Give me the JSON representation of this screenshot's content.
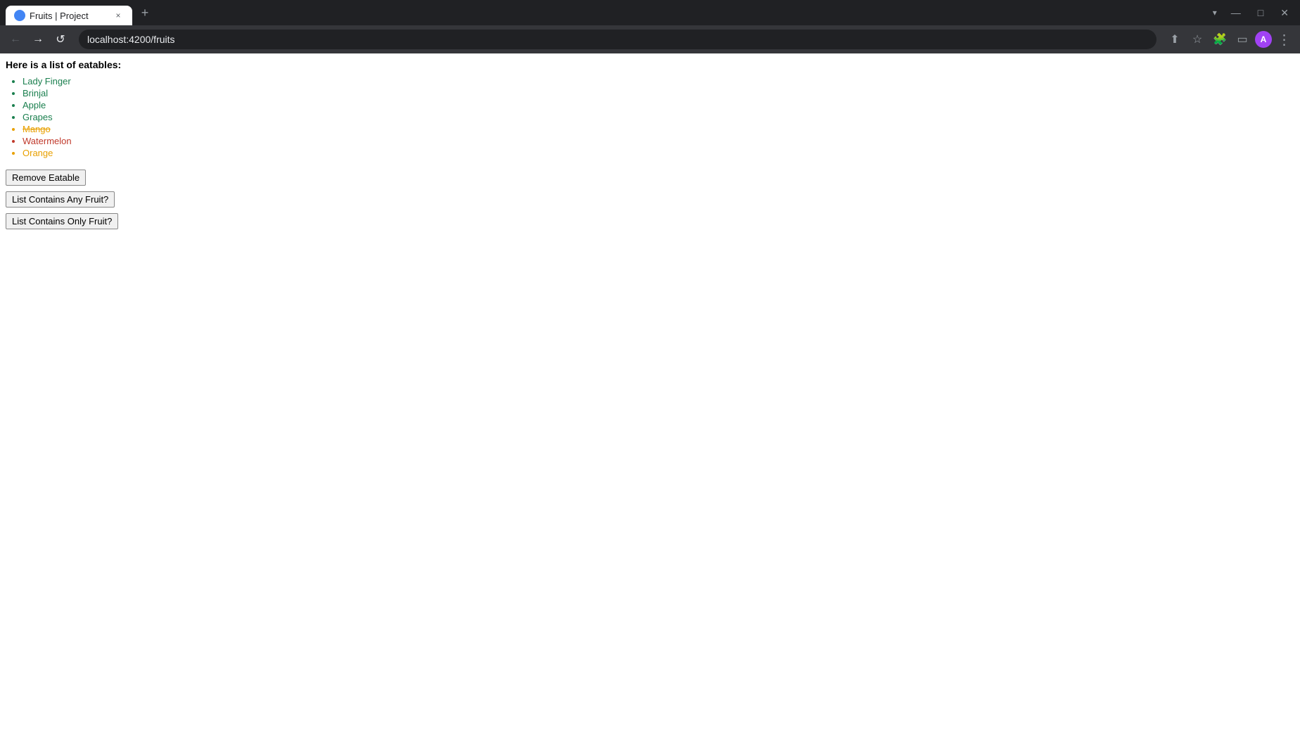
{
  "browser": {
    "tab_title": "Fruits | Project",
    "tab_close_label": "×",
    "tab_new_label": "+",
    "tab_dropdown_label": "▾",
    "address": "localhost:4200/fruits",
    "window_controls": {
      "minimize": "—",
      "maximize": "□",
      "close": "✕"
    }
  },
  "toolbar": {
    "back_label": "←",
    "forward_label": "→",
    "reload_label": "↺",
    "share_label": "⬆",
    "bookmark_label": "☆",
    "extensions_label": "🧩",
    "sidebar_label": "▭",
    "menu_label": "⋮",
    "profile_label": "A"
  },
  "page": {
    "heading": "Here is a list of eatables:",
    "eatables": [
      {
        "name": "Lady Finger",
        "color_class": "item-lady-finger"
      },
      {
        "name": "Brinjal",
        "color_class": "item-brinjal"
      },
      {
        "name": "Apple",
        "color_class": "item-apple"
      },
      {
        "name": "Grapes",
        "color_class": "item-grapes"
      },
      {
        "name": "Mango",
        "color_class": "item-mango"
      },
      {
        "name": "Watermelon",
        "color_class": "item-watermelon"
      },
      {
        "name": "Orange",
        "color_class": "item-orange"
      }
    ],
    "buttons": {
      "remove_eatable": "Remove Eatable",
      "list_contains_any_fruit": "List Contains Any Fruit?",
      "list_contains_only_fruit": "List Contains Only Fruit?"
    }
  }
}
